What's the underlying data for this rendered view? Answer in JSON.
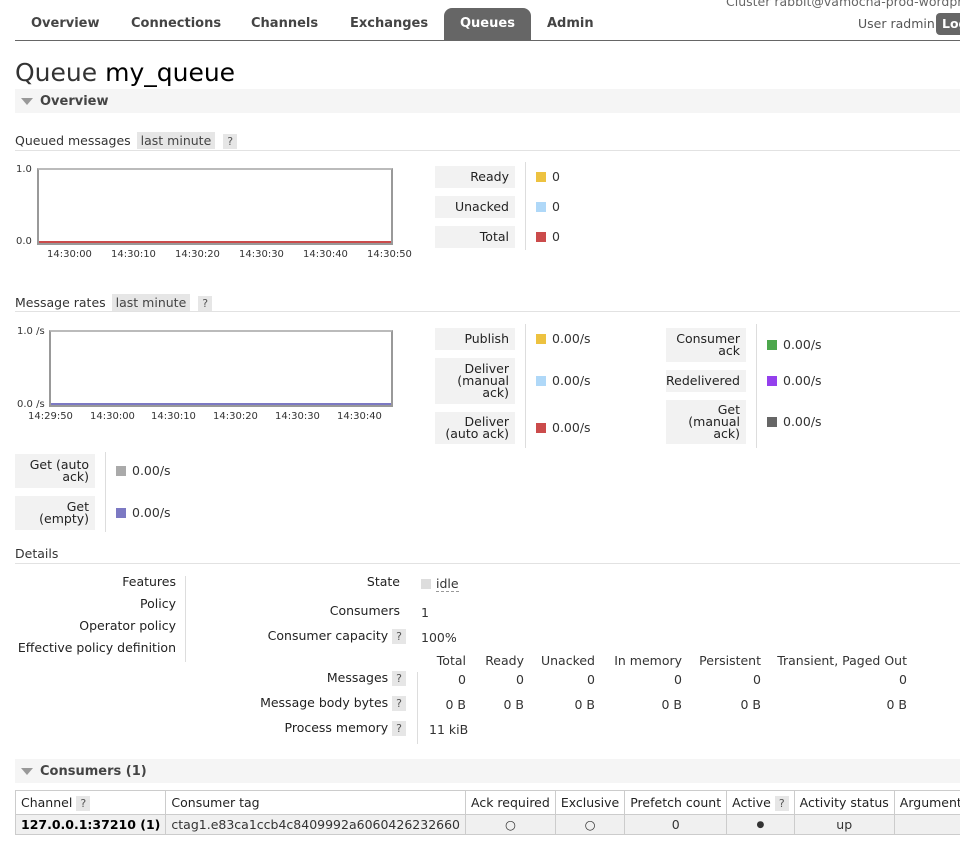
{
  "cluster": "Cluster rabbit@vamocha-prod-wordpress",
  "user": {
    "label": "User radmin",
    "logout": "Log"
  },
  "nav": {
    "tabs": [
      "Overview",
      "Connections",
      "Channels",
      "Exchanges",
      "Queues",
      "Admin"
    ],
    "active": "Queues"
  },
  "title": {
    "prefix": "Queue",
    "name": "my_queue"
  },
  "overview_section": "Overview",
  "help_q": "?",
  "queued_chart": {
    "label": "Queued messages",
    "range": "last minute",
    "chart_data": {
      "type": "line",
      "x": [
        "14:30:00",
        "14:30:10",
        "14:30:20",
        "14:30:30",
        "14:30:40",
        "14:30:50"
      ],
      "y_ticks": [
        "1.0",
        "0.0"
      ],
      "ylim": [
        0,
        1
      ],
      "series": [
        {
          "name": "Ready",
          "values": [
            0,
            0,
            0,
            0,
            0,
            0
          ],
          "color": "#edc240"
        },
        {
          "name": "Unacked",
          "values": [
            0,
            0,
            0,
            0,
            0,
            0
          ],
          "color": "#afd8f8"
        },
        {
          "name": "Total",
          "values": [
            0,
            0,
            0,
            0,
            0,
            0
          ],
          "color": "#cb4b4b"
        }
      ]
    },
    "legend": [
      {
        "label": "Ready",
        "value": "0",
        "color": "#edc240"
      },
      {
        "label": "Unacked",
        "value": "0",
        "color": "#afd8f8"
      },
      {
        "label": "Total",
        "value": "0",
        "color": "#cb4b4b"
      }
    ]
  },
  "rates_chart": {
    "label": "Message rates",
    "range": "last minute",
    "chart_data": {
      "type": "line",
      "x": [
        "14:29:50",
        "14:30:00",
        "14:30:10",
        "14:30:20",
        "14:30:30",
        "14:30:40"
      ],
      "y_ticks": [
        "1.0 /s",
        "0.0 /s"
      ],
      "ylim": [
        0,
        1
      ],
      "series": [
        {
          "name": "Publish",
          "values": [
            0,
            0,
            0,
            0,
            0,
            0
          ],
          "color": "#edc240"
        },
        {
          "name": "Deliver (manual ack)",
          "values": [
            0,
            0,
            0,
            0,
            0,
            0
          ],
          "color": "#afd8f8"
        },
        {
          "name": "Deliver (auto ack)",
          "values": [
            0,
            0,
            0,
            0,
            0,
            0
          ],
          "color": "#cb4b4b"
        },
        {
          "name": "Consumer ack",
          "values": [
            0,
            0,
            0,
            0,
            0,
            0
          ],
          "color": "#4da74d"
        },
        {
          "name": "Redelivered",
          "values": [
            0,
            0,
            0,
            0,
            0,
            0
          ],
          "color": "#9440ed"
        },
        {
          "name": "Get (manual ack)",
          "values": [
            0,
            0,
            0,
            0,
            0,
            0
          ],
          "color": "#666666"
        },
        {
          "name": "Get (auto ack)",
          "values": [
            0,
            0,
            0,
            0,
            0,
            0
          ],
          "color": "#aaaaaa"
        },
        {
          "name": "Get (empty)",
          "values": [
            0,
            0,
            0,
            0,
            0,
            0
          ],
          "color": "#7c79c3"
        }
      ]
    },
    "legend_col1": [
      {
        "lines": [
          "Publish"
        ],
        "value": "0.00/s",
        "color": "#edc240"
      },
      {
        "lines": [
          "Deliver",
          "(manual",
          "ack)"
        ],
        "value": "0.00/s",
        "color": "#afd8f8"
      },
      {
        "lines": [
          "Deliver",
          "(auto ack)"
        ],
        "value": "0.00/s",
        "color": "#cb4b4b"
      }
    ],
    "legend_col2": [
      {
        "lines": [
          "Consumer",
          "ack"
        ],
        "value": "0.00/s",
        "color": "#4da74d"
      },
      {
        "lines": [
          "Redelivered"
        ],
        "value": "0.00/s",
        "color": "#9440ed"
      },
      {
        "lines": [
          "Get",
          "(manual",
          "ack)"
        ],
        "value": "0.00/s",
        "color": "#666666"
      }
    ],
    "legend_col3": [
      {
        "lines": [
          "Get (auto",
          "ack)"
        ],
        "value": "0.00/s",
        "color": "#aaaaaa"
      },
      {
        "lines": [
          "Get",
          "(empty)"
        ],
        "value": "0.00/s",
        "color": "#7c79c3"
      }
    ]
  },
  "details": {
    "heading": "Details",
    "left_labels": [
      "Features",
      "Policy",
      "Operator policy",
      "Effective policy definition"
    ],
    "state_label": "State",
    "state_value": "idle",
    "consumers_label": "Consumers",
    "consumers_value": "1",
    "capacity_label": "Consumer capacity",
    "capacity_value": "100%",
    "stats_headers": [
      "Total",
      "Ready",
      "Unacked",
      "In memory",
      "Persistent",
      "Transient, Paged Out"
    ],
    "messages_label": "Messages",
    "messages_values": [
      "0",
      "0",
      "0",
      "0",
      "0",
      "0"
    ],
    "body_bytes_label": "Message body bytes",
    "body_bytes_values": [
      "0 B",
      "0 B",
      "0 B",
      "0 B",
      "0 B",
      "0 B"
    ],
    "process_memory_label": "Process memory",
    "process_memory_value": "11 kiB"
  },
  "consumers": {
    "section": "Consumers (1)",
    "headers": [
      "Channel",
      "Consumer tag",
      "Ack required",
      "Exclusive",
      "Prefetch count",
      "Active",
      "Activity status",
      "Arguments"
    ],
    "row": {
      "channel": "127.0.0.1:37210 (1)",
      "tag": "ctag1.e83ca1ccb4c8409992a6060426232660",
      "ack_required": "○",
      "exclusive": "○",
      "prefetch": "0",
      "active": "●",
      "activity_status": "up",
      "arguments": ""
    }
  }
}
